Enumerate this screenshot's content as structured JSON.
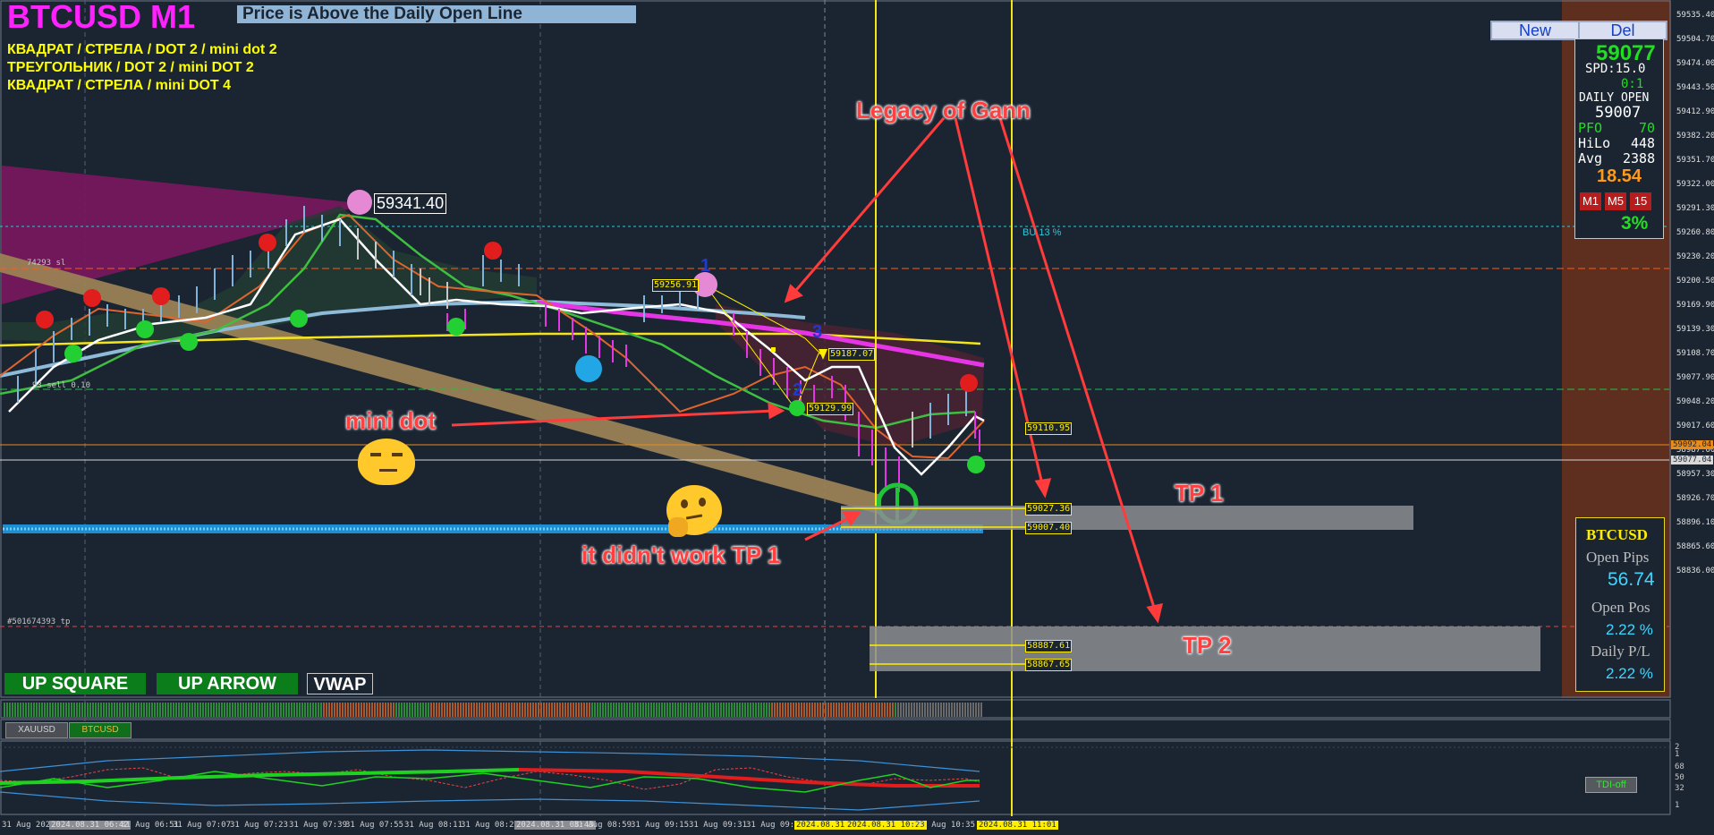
{
  "header": {
    "symbol_title": "BTCUSD M1",
    "status_banner": "Price is Above the Daily Open Line",
    "strategy_lines": [
      "КВАДРАТ / СТРЕЛА / DOT 2 / mini dot 2",
      "ТРЕУГОЛЬНИК / DOT 2 / mini DOT 2",
      "КВАДРАТ / СТРЕЛА /  mini DOT 4"
    ]
  },
  "top_buttons": {
    "new_label": "New",
    "del_label": "Del"
  },
  "info_panel": {
    "price_main": "59077",
    "spread": "SPD:15.0",
    "ratio": "0:1",
    "daily_open_label": "DAILY OPEN",
    "daily_open_value": "59007",
    "pfo_label": "PFO",
    "pfo_value": "70",
    "hilo_label": "HiLo",
    "hilo_value": "448",
    "avg_label": "Avg",
    "avg_value": "2388",
    "orange_value": "18.54",
    "tf_buttons": [
      "M1",
      "M5",
      "15"
    ],
    "percent": "3%"
  },
  "account_panel": {
    "symbol": "BTCUSD",
    "open_pips_label": "Open Pips",
    "open_pips_value": "56.74",
    "open_pos_label": "Open Pos",
    "open_pos_value": "2.22 %",
    "daily_pl_label": "Daily P/L",
    "daily_pl_value": "2.22 %"
  },
  "price_axis": [
    "59535.40",
    "59504.70",
    "59474.00",
    "59443.50",
    "59412.90",
    "59382.20",
    "59351.70",
    "59322.00",
    "59291.30",
    "59260.80",
    "59230.20",
    "59200.50",
    "59169.90",
    "59139.30",
    "59108.70",
    "59077.90",
    "59048.20",
    "59017.60",
    "58987.00",
    "58957.30",
    "58926.70",
    "58896.10",
    "58865.60",
    "58836.00"
  ],
  "price_axis_hl": {
    "daily_open": "59092.04",
    "current": "59077.04"
  },
  "time_axis": [
    "31 Aug 2024",
    "2024.08.31 06:42",
    "31 Aug 06:51",
    "31 Aug 07:07",
    "31 Aug 07:23",
    "31 Aug 07:39",
    "31 Aug 07:55",
    "31 Aug 08:11",
    "31 Aug 08:2",
    "2024.08.31 08:43",
    "31 Aug 08:59",
    "31 Aug 09:15",
    "31 Aug 09:31",
    "31 Aug 09:4",
    "2024.08.31",
    "2024.08.31 10:23",
    "31 Aug 10:35",
    "2024.08.31 11:01"
  ],
  "chart_labels": {
    "high_price": "59341.40",
    "tag_left_1": "59256.91",
    "tag_2": "59129.99",
    "tag_3": "59187.07",
    "tag_4": "59110.95",
    "tag_tp1a": "59027.36",
    "tag_tp1b": "59007.40",
    "tag_tp2a": "58887.61",
    "tag_tp2b": "58867.65",
    "sl_label": "74293 sl",
    "sell_label": "93 sell 0.10",
    "tp_label": "#501674393 tp",
    "pct_label": "BU 13 %",
    "wave_1": "1",
    "wave_2": "2",
    "wave_3": "3"
  },
  "annotations": {
    "legacy": "Legacy of Gann",
    "mini_dot": "mini dot",
    "didnt_work": "it didn't work  TP 1",
    "tp1": "TP 1",
    "tp2": "TP 2"
  },
  "bottom_buttons": {
    "up_square": "UP SQUARE",
    "up_arrow": "UP ARROW",
    "vwap": "VWAP"
  },
  "symbol_tabs": [
    "XAUUSD",
    "BTCUSD"
  ],
  "indicator": {
    "toggle_label": "TDI-off",
    "levels": [
      "2",
      "1",
      "68",
      "50",
      "32",
      "1"
    ]
  },
  "colors": {
    "background": "#1b2532",
    "title_magenta": "#ff22ff",
    "yellow": "#ffff00",
    "panel_brown": "#5e2e1f",
    "annotation_red": "#ff3b3b"
  },
  "icons": [
    "thinking-face-emoji",
    "unamused-face-emoji",
    "target-circle-icon"
  ]
}
